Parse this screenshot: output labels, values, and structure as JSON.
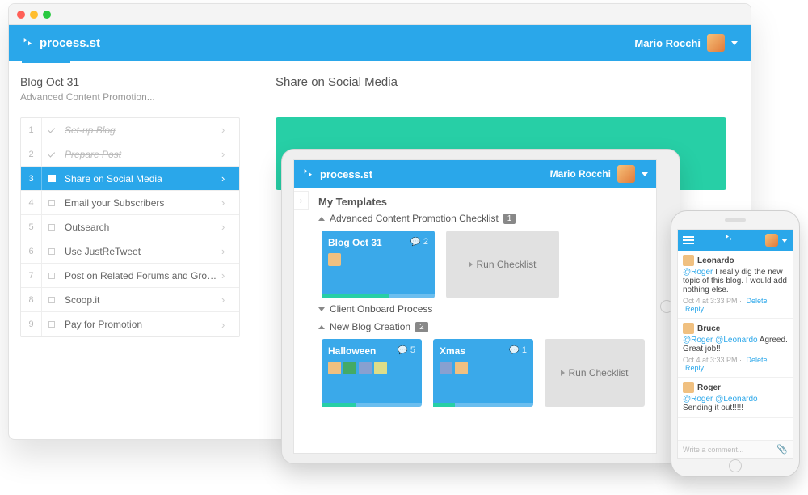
{
  "brand": "process.st",
  "user": "Mario Rocchi",
  "desktop": {
    "sidebar": {
      "title": "Blog Oct 31",
      "subtitle": "Advanced Content Promotion...",
      "tasks": [
        {
          "n": "1",
          "label": "Set-up Blog",
          "done": true
        },
        {
          "n": "2",
          "label": "Prepare Post",
          "done": true
        },
        {
          "n": "3",
          "label": "Share on Social Media",
          "active": true
        },
        {
          "n": "4",
          "label": "Email your Subscribers"
        },
        {
          "n": "5",
          "label": "Outsearch"
        },
        {
          "n": "6",
          "label": "Use JustReTweet"
        },
        {
          "n": "7",
          "label": "Post on Related Forums and Groups"
        },
        {
          "n": "8",
          "label": "Scoop.it"
        },
        {
          "n": "9",
          "label": "Pay for Promotion"
        }
      ]
    },
    "main": {
      "title": "Share on Social Media"
    }
  },
  "tablet": {
    "section": "My Templates",
    "templates": [
      {
        "name": "Advanced Content Promotion Checklist",
        "count": "1",
        "expanded": true
      },
      {
        "name": "Client Onboard Process",
        "expanded": false
      },
      {
        "name": "New Blog Creation",
        "count": "2",
        "expanded": true
      }
    ],
    "cards_a": [
      {
        "title": "Blog Oct 31",
        "comments": "2",
        "progress": 60
      }
    ],
    "cards_b": [
      {
        "title": "Halloween",
        "comments": "5",
        "progress": 35
      },
      {
        "title": "Xmas",
        "comments": "1",
        "progress": 22
      }
    ],
    "run": "Run Checklist"
  },
  "phone": {
    "posts": [
      {
        "author": "Leonardo",
        "body_pre": "@Roger",
        "body": " I really dig the new topic of this blog. I would add nothing else.",
        "meta": "Oct 4 at 3:33 PM",
        "del": "Delete",
        "reply": "Reply"
      },
      {
        "author": "Bruce",
        "body_pre": "@Roger @Leonardo",
        "body": " Agreed. Great job!!",
        "meta": "Oct 4 at 3:33 PM",
        "del": "Delete",
        "reply": "Reply"
      },
      {
        "author": "Roger",
        "body_pre": "@Roger @Leonardo",
        "body": " Sending it out!!!!!",
        "meta": ""
      }
    ],
    "compose": "Write a comment..."
  }
}
